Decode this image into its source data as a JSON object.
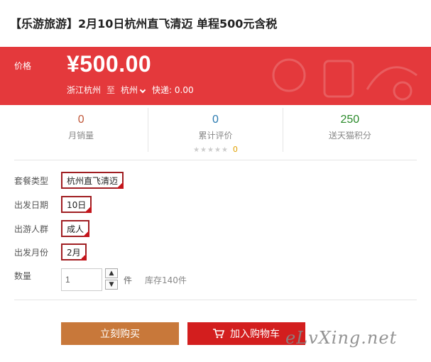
{
  "product": {
    "title": "【乐游旅游】2月10日杭州直飞清迈 单程500元含税"
  },
  "price": {
    "label": "价格",
    "value": "¥500.00",
    "origin": "浙江杭州",
    "to_word": "至",
    "destination": "杭州",
    "shipping": "快递: 0.00"
  },
  "stats": [
    {
      "value": "0",
      "label": "月销量",
      "color": "#c0583a"
    },
    {
      "value": "0",
      "label": "累计评价",
      "color": "#2a7ab0"
    },
    {
      "value": "250",
      "label": "送天猫积分",
      "color": "#2a8a2a"
    }
  ],
  "rating": {
    "stars": "★★★★★",
    "count": "0"
  },
  "options": {
    "package": {
      "label": "套餐类型",
      "value": "杭州直飞清迈"
    },
    "date": {
      "label": "出发日期",
      "value": "10日"
    },
    "people": {
      "label": "出游人群",
      "value": "成人"
    },
    "month": {
      "label": "出发月份",
      "value": "2月"
    }
  },
  "quantity": {
    "label": "数量",
    "value": "1",
    "up": "▲",
    "down": "▼",
    "unit": "件",
    "stock": "库存140件"
  },
  "actions": {
    "buy_now": "立刻购买",
    "add_to_cart": "加入购物车"
  },
  "watermark": "eLvXing.net",
  "colors": {
    "accent": "#e4393c",
    "buy": "#c8783a",
    "cart": "#d31e1e"
  }
}
